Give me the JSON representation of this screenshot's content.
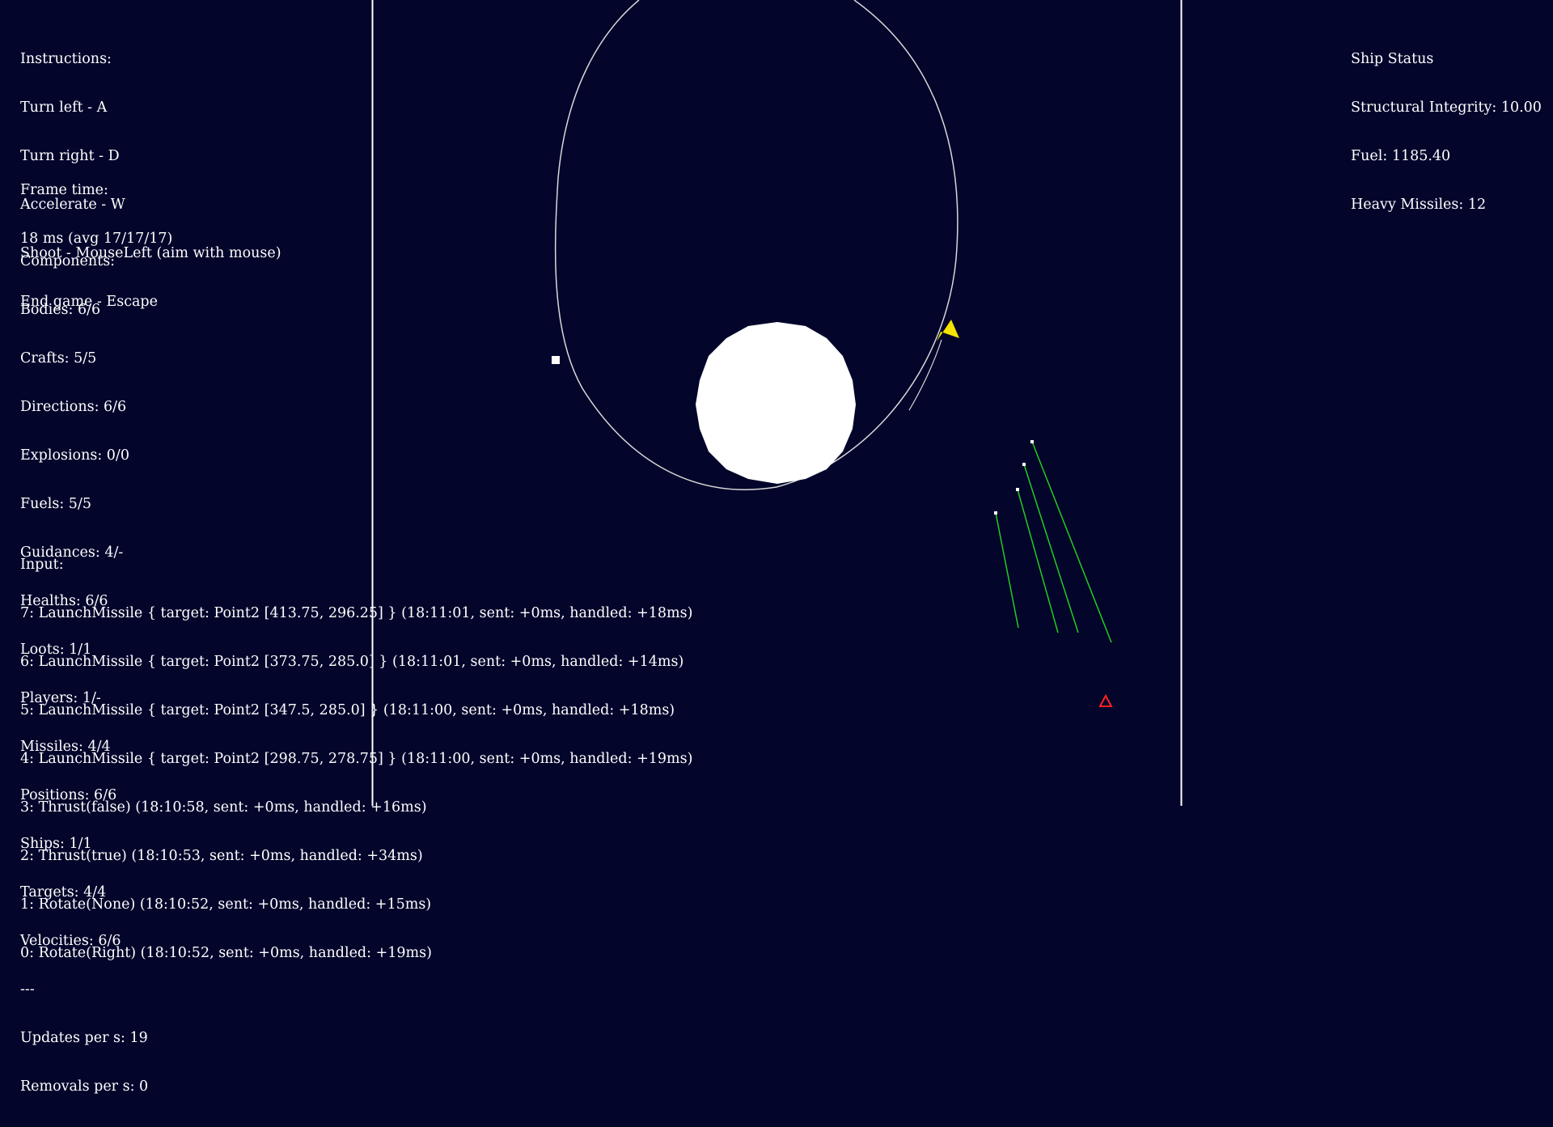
{
  "colors": {
    "background": "#03052b",
    "text": "#ffffff",
    "boundary": "#ffffff",
    "orbit": "#d8d8d8",
    "planet": "#ffffff",
    "player_ship": "#f5e400",
    "missile_trail": "#22cc22",
    "enemy": "#ff2020"
  },
  "instructions": {
    "title": "Instructions:",
    "lines": [
      "Turn left - A",
      "Turn right - D",
      "Accelerate - W",
      "Shoot - MouseLeft (aim with mouse)",
      "End game - Escape"
    ]
  },
  "frame_time": {
    "title": "Frame time:",
    "value": "18 ms (avg 17/17/17)"
  },
  "components": {
    "title": "Components:",
    "lines": [
      "Bodies: 6/6",
      "Crafts: 5/5",
      "Directions: 6/6",
      "Explosions: 0/0",
      "Fuels: 5/5",
      "Guidances: 4/-",
      "Healths: 6/6",
      "Loots: 1/1",
      "Players: 1/-",
      "Missiles: 4/4",
      "Positions: 6/6",
      "Ships: 1/1",
      "Targets: 4/4",
      "Velocities: 6/6",
      "---",
      "Updates per s: 19",
      "Removals per s: 0"
    ]
  },
  "input": {
    "title": "Input:",
    "lines": [
      "7: LaunchMissile { target: Point2 [413.75, 296.25] } (18:11:01, sent: +0ms, handled: +18ms)",
      "6: LaunchMissile { target: Point2 [373.75, 285.0] } (18:11:01, sent: +0ms, handled: +14ms)",
      "5: LaunchMissile { target: Point2 [347.5, 285.0] } (18:11:00, sent: +0ms, handled: +18ms)",
      "4: LaunchMissile { target: Point2 [298.75, 278.75] } (18:11:00, sent: +0ms, handled: +19ms)",
      "3: Thrust(false) (18:10:58, sent: +0ms, handled: +16ms)",
      "2: Thrust(true) (18:10:53, sent: +0ms, handled: +34ms)",
      "1: Rotate(None) (18:10:52, sent: +0ms, handled: +15ms)",
      "0: Rotate(Right) (18:10:52, sent: +0ms, handled: +19ms)"
    ]
  },
  "ship_status": {
    "title": "Ship Status",
    "lines": [
      "Structural Integrity: 10.00",
      "Fuel: 1185.40",
      "Heavy Missiles: 12"
    ]
  }
}
